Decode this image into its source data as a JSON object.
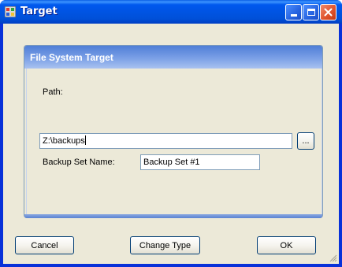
{
  "window": {
    "title": "Target"
  },
  "group": {
    "title": "File System Target"
  },
  "path": {
    "label": "Path:",
    "value": "Z:\\backups",
    "browse_label": "..."
  },
  "backup_set": {
    "label": "Backup Set Name:",
    "value": "Backup Set #1"
  },
  "buttons": {
    "cancel": "Cancel",
    "change_type": "Change Type",
    "ok": "OK"
  },
  "colors": {
    "title_bar": "#0054e3",
    "dialog_bg": "#ece9d8",
    "group_header": "#7ba0e6",
    "close_button": "#e1552e"
  },
  "icons": [
    "app-icon",
    "minimize-icon",
    "maximize-icon",
    "close-icon",
    "resize-grip-icon"
  ]
}
